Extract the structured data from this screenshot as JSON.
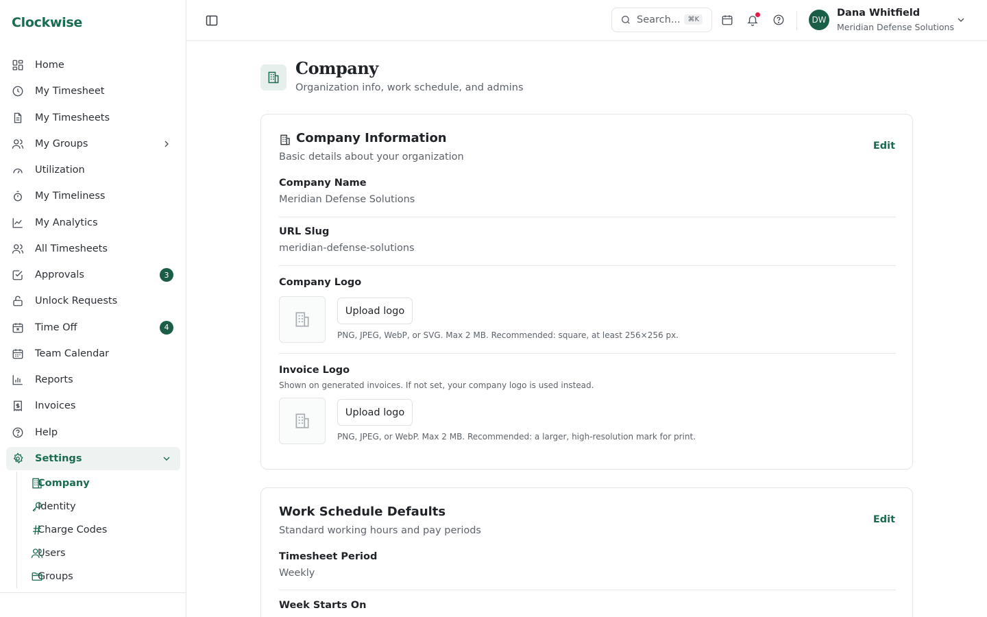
{
  "app": {
    "brand": "Clockwise"
  },
  "sidebar": {
    "items": [
      {
        "label": "Home",
        "icon": "home-grid-icon"
      },
      {
        "label": "My Timesheet",
        "icon": "clock-icon"
      },
      {
        "label": "My Timesheets",
        "icon": "document-icon"
      },
      {
        "label": "My Groups",
        "icon": "users-icon"
      },
      {
        "label": "Utilization",
        "icon": "gauge-icon"
      },
      {
        "label": "My Timeliness",
        "icon": "stopwatch-icon"
      },
      {
        "label": "My Analytics",
        "icon": "line-chart-icon"
      },
      {
        "label": "All Timesheets",
        "icon": "users-icon"
      },
      {
        "label": "Approvals",
        "icon": "check-square-icon",
        "badge": "3"
      },
      {
        "label": "Unlock Requests",
        "icon": "lock-open-icon"
      },
      {
        "label": "Time Off",
        "icon": "calendar-x-icon",
        "badge": "4"
      },
      {
        "label": "Team Calendar",
        "icon": "calendar-icon"
      },
      {
        "label": "Reports",
        "icon": "bar-chart-icon"
      },
      {
        "label": "Invoices",
        "icon": "receipt-icon"
      },
      {
        "label": "Help",
        "icon": "help-circle-icon"
      },
      {
        "label": "Settings",
        "icon": "gear-icon"
      }
    ],
    "settings_sub": [
      {
        "label": "Company",
        "icon": "building-icon"
      },
      {
        "label": "Identity",
        "icon": "key-icon"
      },
      {
        "label": "Charge Codes",
        "icon": "hash-icon"
      },
      {
        "label": "Users",
        "icon": "users-icon"
      },
      {
        "label": "Groups",
        "icon": "folder-icon"
      }
    ],
    "accent_color": "#1a6b52",
    "badge_color": "#1b5e48"
  },
  "header": {
    "search_placeholder": "Search...",
    "search_shortcut": "⌘K",
    "user": {
      "initials": "DW",
      "name": "Dana Whitfield",
      "org": "Meridian Defense Solutions"
    },
    "notification_dot_color": "#e11d48"
  },
  "page": {
    "title": "Company",
    "subtitle": "Organization info, work schedule, and admins"
  },
  "company_card": {
    "title": "Company Information",
    "desc": "Basic details about your organization",
    "edit": "Edit",
    "fields": [
      {
        "label": "Company Name",
        "value": "Meridian Defense Solutions"
      },
      {
        "label": "URL Slug",
        "value": "meridian-defense-solutions"
      }
    ],
    "logo": {
      "label": "Company Logo",
      "button": "Upload logo",
      "hint": "PNG, JPEG, WebP, or SVG. Max 2 MB. Recommended: square, at least 256×256 px."
    },
    "invoice_logo": {
      "label": "Invoice Logo",
      "help": "Shown on generated invoices. If not set, your company logo is used instead.",
      "button": "Upload logo",
      "hint": "PNG, JPEG, or WebP. Max 2 MB. Recommended: a larger, high-resolution mark for print."
    }
  },
  "schedule_card": {
    "title": "Work Schedule Defaults",
    "desc": "Standard working hours and pay periods",
    "edit": "Edit",
    "fields": [
      {
        "label": "Timesheet Period",
        "value": "Weekly"
      },
      {
        "label": "Week Starts On",
        "value": ""
      }
    ]
  }
}
